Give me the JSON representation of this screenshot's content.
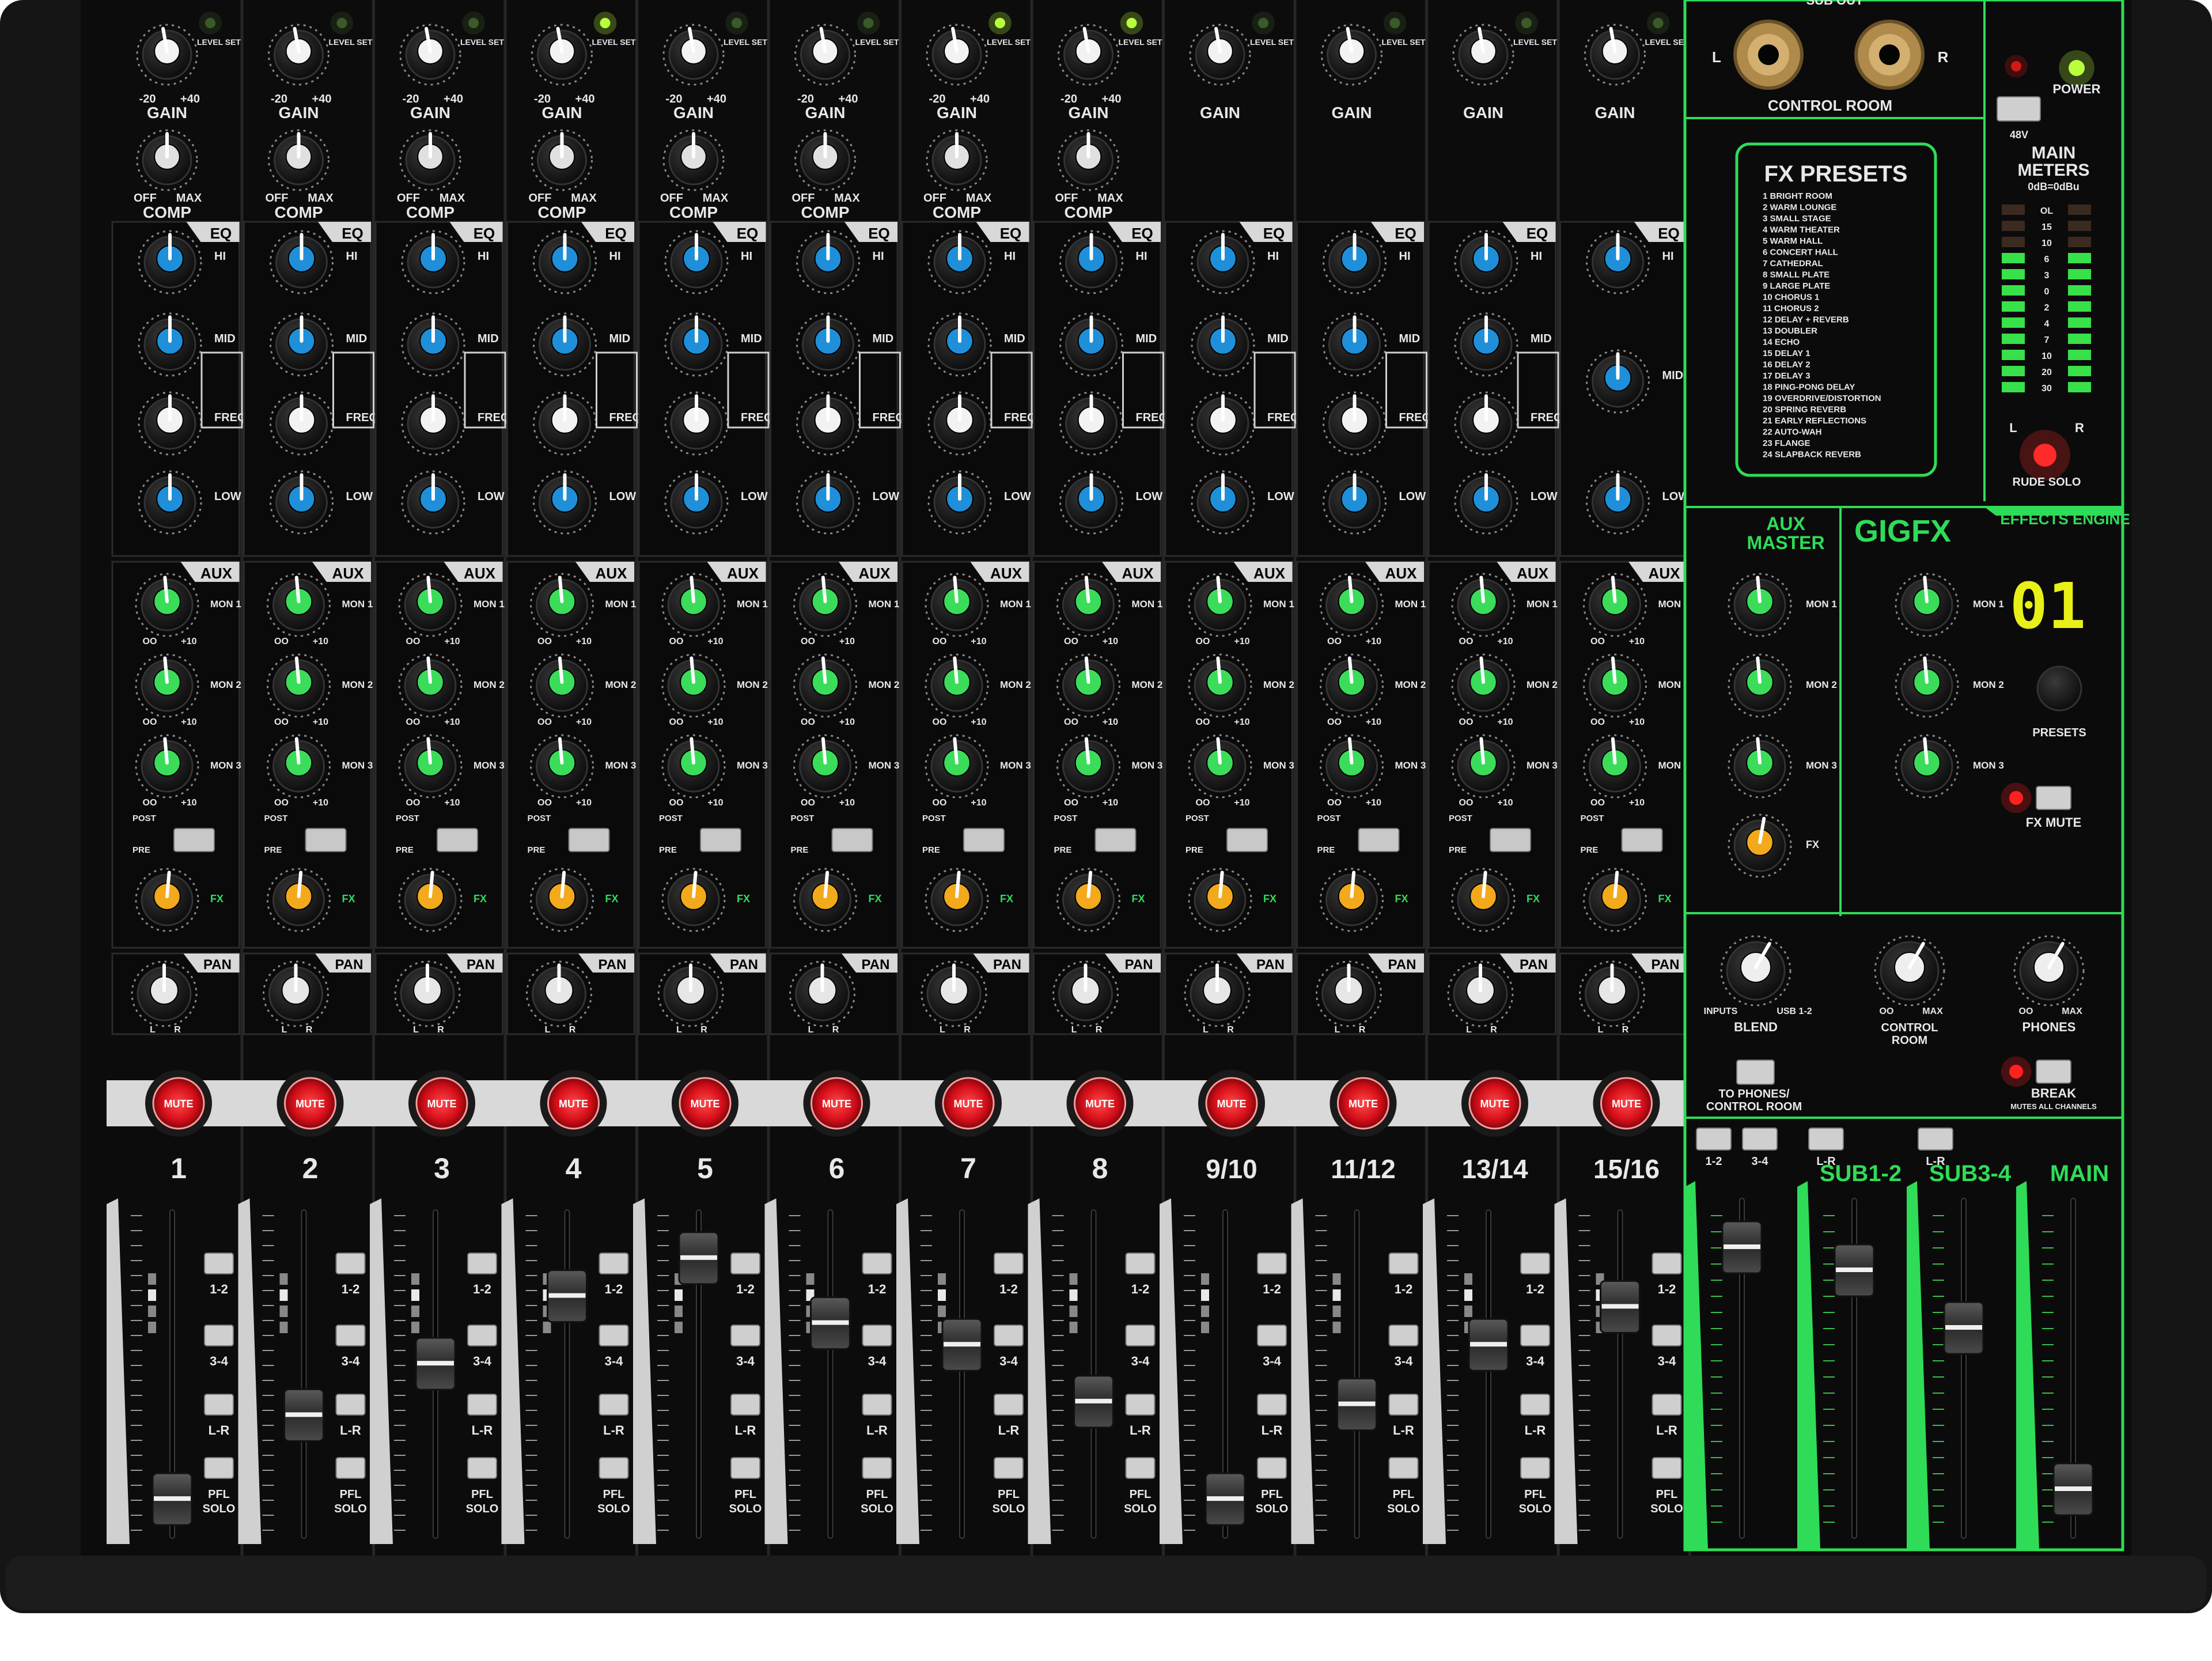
{
  "colors": {
    "case": "#141414",
    "panel": "#0d0d0d",
    "silkscreen": "#e8e8e8",
    "eq_knob": "#1e8fd8",
    "aux_knob": "#3bdc5a",
    "fx_knob": "#f2a91c",
    "mute_red": "#e0101e",
    "accent_green": "#2fdc57",
    "meter_green": "#38e04a",
    "meter_yellow": "#f4e21a",
    "meter_red": "#e21b1b"
  },
  "input_section": {
    "gain_label": "GAIN",
    "comp_label": "COMP",
    "level_set": "LEVEL SET",
    "gain_min": "-20",
    "gain_max": "+40",
    "comp_min": "OFF",
    "comp_max": "MAX",
    "eq_tab": "EQ",
    "aux_tab": "AUX",
    "pan_tab": "PAN",
    "mute_label": "MUTE",
    "eq_bands": [
      "HI",
      "MID",
      "FREQ",
      "LOW"
    ],
    "aux_sends": [
      "MON 1",
      "MON 2",
      "MON 3"
    ],
    "fx_label": "FX",
    "post_label": "POST",
    "pre_label": "PRE",
    "pan_left": "L",
    "pan_right": "R",
    "bus_buttons": [
      "1-2",
      "3-4",
      "L-R"
    ],
    "pfl_solo": "PFL SOLO"
  },
  "channels": [
    "1",
    "2",
    "3",
    "4",
    "5",
    "6",
    "7",
    "8",
    "9/10",
    "11/12",
    "13/14",
    "15/16"
  ],
  "right_panel": {
    "sub_out": "SUB OUT",
    "control_room": "CONTROL ROOM",
    "control_room_left": "L",
    "control_room_right": "R",
    "phantom": "48V",
    "power": "POWER",
    "main_meters": "MAIN METERS",
    "meter_range": "0dB=0dBu",
    "meter_scale": [
      "OL",
      "15",
      "10",
      "6",
      "3",
      "0",
      "2",
      "4",
      "7",
      "10",
      "20",
      "30"
    ],
    "meter_left": "L",
    "meter_right": "R",
    "rude_solo": "RUDE SOLO",
    "fx_presets_title": "FX PRESETS",
    "fx_presets": [
      "1 BRIGHT ROOM",
      "2 WARM LOUNGE",
      "3 SMALL STAGE",
      "4 WARM THEATER",
      "5 WARM HALL",
      "6 CONCERT HALL",
      "7 CATHEDRAL",
      "8 SMALL PLATE",
      "9 LARGE PLATE",
      "10 CHORUS 1",
      "11 CHORUS 2",
      "12 DELAY + REVERB",
      "13 DOUBLER",
      "14 ECHO",
      "15 DELAY 1",
      "16 DELAY 2",
      "17 DELAY 3",
      "18 PING-PONG DELAY",
      "19 OVERDRIVE/DISTORTION",
      "20 SPRING REVERB",
      "21 EARLY REFLECTIONS",
      "22 AUTO-WAH",
      "23 FLANGE",
      "24 SLAPBACK REVERB"
    ],
    "aux_master": "AUX MASTER",
    "gigfx_logo": "GIGFX",
    "effects_engine": "EFFECTS ENGINE",
    "fx_display": "01",
    "presets": "PRESETS",
    "fx_mute": "FX MUTE",
    "blend": "BLEND",
    "blend_left": "INPUTS",
    "blend_right": "USB 1-2",
    "control_room_knob": "CONTROL ROOM",
    "phones": "PHONES",
    "to_phones": "TO PHONES/ CONTROL ROOM",
    "break": "BREAK",
    "break_sub": "MUTES ALL CHANNELS",
    "knob_min": "OO",
    "knob_max": "MAX",
    "send_min": "OO",
    "send_max": "+10",
    "sub12": "SUB1-2",
    "sub34": "SUB3-4",
    "main": "MAIN",
    "lr": "L-R",
    "bus12": "1-2",
    "bus34": "3-4"
  }
}
